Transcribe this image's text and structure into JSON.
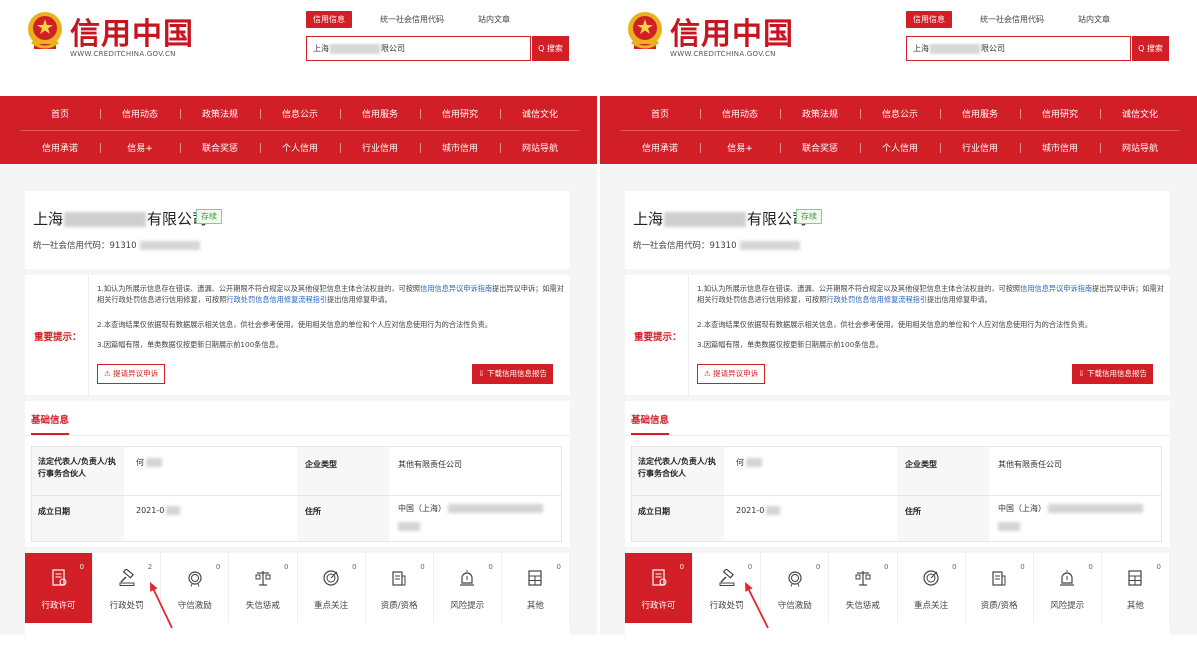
{
  "header": {
    "brand": "信用中国",
    "brand_url": "WWW.CREDITCHINA.GOV.CN",
    "search_tabs": [
      "信用信息",
      "统一社会信用代码",
      "站内文章"
    ],
    "search_prefix": "上海",
    "search_suffix": "限公司",
    "search_button": "Q 搜索"
  },
  "nav": {
    "row1": [
      "首页",
      "信用动态",
      "政策法规",
      "信息公示",
      "信用服务",
      "信用研究",
      "诚信文化"
    ],
    "row2": [
      "信用承诺",
      "信易+",
      "联合奖惩",
      "个人信用",
      "行业信用",
      "城市信用",
      "网站导航"
    ]
  },
  "company": {
    "name_prefix": "上海",
    "name_suffix": "有限公司",
    "status": "存续",
    "code_label": "统一社会信用代码：",
    "code_prefix": "91310"
  },
  "notice": {
    "label": "重要提示：",
    "line1_a": "1.如认为所展示信息存在错误、遗漏、公开期限不符合规定以及其他侵犯信息主体合法权益的，可按照",
    "line1_link": "信用信息异议申诉指南",
    "line1_b": "提出异议申诉；如需对相关行政处罚信息进行信用修复，可按照",
    "line1_link2": "行政处罚信息信用修复流程指引",
    "line1_c": "提出信用修复申请。",
    "line2": "2.本查询结果仅依据现有数据展示相关信息，供社会参考使用。使用相关信息的单位和个人应对信息使用行为的合法性负责。",
    "line3": "3.因篇幅有限，单类数据仅按更新日期展示前100条信息。",
    "objection_button": "⚠ 提请异议申诉",
    "download_button": "⇩ 下载信用信息报告"
  },
  "basic": {
    "title": "基础信息",
    "legal_label": "法定代表人/负责人/执行事务合伙人",
    "legal_value": "何",
    "type_label": "企业类型",
    "type_value": "其他有限责任公司",
    "date_label": "成立日期",
    "date_value": "2021-0",
    "address_label": "住所",
    "address_value": "中国（上海）"
  },
  "categories_left": [
    {
      "label": "行政许可",
      "count": "0",
      "icon": "permit-icon"
    },
    {
      "label": "行政处罚",
      "count": "2",
      "icon": "gavel-icon"
    },
    {
      "label": "守信激励",
      "count": "0",
      "icon": "medal-icon"
    },
    {
      "label": "失信惩戒",
      "count": "0",
      "icon": "scales-icon"
    },
    {
      "label": "重点关注",
      "count": "0",
      "icon": "target-icon"
    },
    {
      "label": "资质/资格",
      "count": "0",
      "icon": "certificate-icon"
    },
    {
      "label": "风险提示",
      "count": "0",
      "icon": "alarm-icon"
    },
    {
      "label": "其他",
      "count": "0",
      "icon": "other-icon"
    }
  ],
  "categories_right": [
    {
      "label": "行政许可",
      "count": "0",
      "icon": "permit-icon"
    },
    {
      "label": "行政处罚",
      "count": "0",
      "icon": "gavel-icon"
    },
    {
      "label": "守信激励",
      "count": "0",
      "icon": "medal-icon"
    },
    {
      "label": "失信惩戒",
      "count": "0",
      "icon": "scales-icon"
    },
    {
      "label": "重点关注",
      "count": "0",
      "icon": "target-icon"
    },
    {
      "label": "资质/资格",
      "count": "0",
      "icon": "certificate-icon"
    },
    {
      "label": "风险提示",
      "count": "0",
      "icon": "alarm-icon"
    },
    {
      "label": "其他",
      "count": "0",
      "icon": "other-icon"
    }
  ],
  "colors": {
    "brand_red": "#d21e26",
    "link_blue": "#2a63b8",
    "status_green": "#3a9a3a"
  }
}
